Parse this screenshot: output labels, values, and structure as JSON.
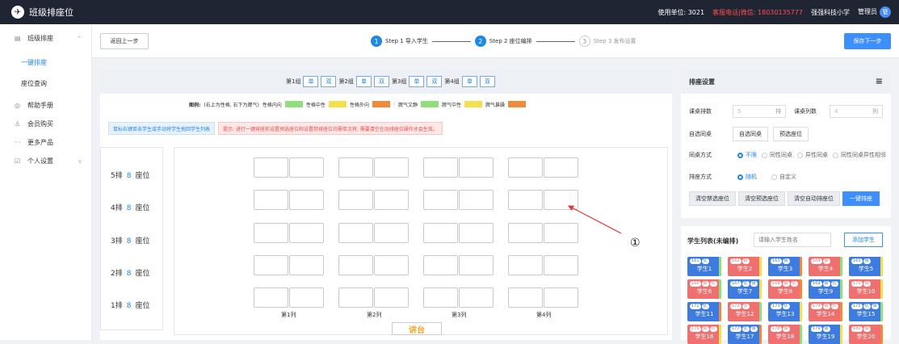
{
  "app": {
    "title": "班级排座位",
    "logo_glyph": "✈"
  },
  "topbar": {
    "unit": "使用单位: 3021",
    "hotline": "客服电话|微信: 18030135777",
    "school": "强强科技小学",
    "user": "管理员",
    "avatar_glyph": "管"
  },
  "sidebar": {
    "items": [
      {
        "label": "班级排座",
        "icon": "▤",
        "arrow": "^"
      },
      {
        "label": "一键排座"
      },
      {
        "label": "座位查询"
      },
      {
        "label": "帮助手册",
        "icon": "◎"
      },
      {
        "label": "会员购买",
        "icon": "♙"
      },
      {
        "label": "更多产品",
        "icon": "···"
      },
      {
        "label": "个人设置",
        "icon": "☑",
        "arrow": "v"
      }
    ]
  },
  "header": {
    "back": "返回上一步",
    "next": "保存下一步",
    "steps": [
      {
        "num": "1",
        "label": "Step 1 导入学生"
      },
      {
        "num": "2",
        "label": "Step 2 座位编排"
      },
      {
        "num": "3",
        "label": "Step 3 发布设置"
      }
    ]
  },
  "groups": [
    {
      "label": "第1组",
      "a": "单",
      "b": "双"
    },
    {
      "label": "第2组",
      "a": "单",
      "b": "双"
    },
    {
      "label": "第3组",
      "a": "单",
      "b": "双"
    },
    {
      "label": "第4组",
      "a": "单",
      "b": "双"
    }
  ],
  "legend": {
    "title": "图例:",
    "note": "(右上为性格, 右下为脾气)",
    "items": [
      {
        "label": "性格内向",
        "color": "#8ee07a"
      },
      {
        "label": "性格中性",
        "color": "#f5e04a"
      },
      {
        "label": "性格外向",
        "color": "#f08a3a"
      },
      {
        "label": "脾气文静",
        "color": "#8ee07a"
      },
      {
        "label": "脾气中性",
        "color": "#f5e04a"
      },
      {
        "label": "脾气暴躁",
        "color": "#f08a3a"
      }
    ]
  },
  "tips": {
    "blue": "鼠标右键单击学生或手动将学生拖回学生列表",
    "red": "提示: 进行一键排座前设置预选座位和设置禁排座位均需单次将, 需要清空在动排座位操作才会生效。"
  },
  "rows": [
    {
      "label": "5排",
      "count": "8",
      "suffix": "座位"
    },
    {
      "label": "4排",
      "count": "8",
      "suffix": "座位"
    },
    {
      "label": "3排",
      "count": "8",
      "suffix": "座位"
    },
    {
      "label": "2排",
      "count": "8",
      "suffix": "座位"
    },
    {
      "label": "1排",
      "count": "8",
      "suffix": "座位"
    }
  ],
  "columns": [
    "第1列",
    "第2列",
    "第3列",
    "第4列"
  ],
  "podium": "讲台",
  "annotation": "①",
  "settings": {
    "title": "排座设置",
    "desk_rows_label": "课桌排数",
    "desk_rows_value": "5",
    "desk_rows_unit": "排",
    "desk_cols_label": "课桌列数",
    "desk_cols_value": "4",
    "desk_cols_unit": "列",
    "self_select_label": "自选同桌",
    "self_select_btn": "自选同桌",
    "preselect_btn": "预选座位",
    "desk_mode_label": "同桌方式",
    "desk_modes": [
      "不限",
      "同性同桌",
      "异性同桌",
      "同性同桌异性相邻"
    ],
    "seat_mode_label": "排座方式",
    "seat_modes": [
      "随机",
      "自定义"
    ],
    "btn_clear_forbid": "清空禁选座位",
    "btn_clear_pre": "清空预选座位",
    "btn_clear_auto": "清空自动排座位",
    "btn_auto": "一键排座"
  },
  "students": {
    "title": "学生列表(未编排)",
    "search_placeholder": "请输入学生姓名",
    "add": "添加学生",
    "list": [
      {
        "name": "学生1",
        "tags": [
          "161",
          "优"
        ],
        "g": "m",
        "c": "#8ee07a"
      },
      {
        "name": "学生2",
        "tags": [
          "162",
          "良"
        ],
        "g": "f",
        "c": "#f5e04a"
      },
      {
        "name": "学生3",
        "tags": [
          "163",
          "良"
        ],
        "g": "m",
        "c": "#f08a3a"
      },
      {
        "name": "学生4",
        "tags": [
          "164",
          "良"
        ],
        "g": "f",
        "c": "#8ee07a"
      },
      {
        "name": "学生5",
        "tags": [
          "165",
          "良"
        ],
        "g": "m",
        "c": "#f5e04a"
      },
      {
        "name": "学生6",
        "tags": [
          "166",
          "良",
          "优"
        ],
        "g": "f",
        "c": "#8ee07a"
      },
      {
        "name": "学生7",
        "tags": [
          "167",
          "优",
          "良"
        ],
        "g": "m",
        "c": "#f5e04a"
      },
      {
        "name": "学生8",
        "tags": [
          "168",
          "良",
          "优"
        ],
        "g": "f",
        "c": "#f08a3a"
      },
      {
        "name": "学生9",
        "tags": [
          "169",
          "良",
          "优"
        ],
        "g": "m",
        "c": "#8ee07a"
      },
      {
        "name": "学生10",
        "tags": [
          "170",
          "良"
        ],
        "g": "f",
        "c": "#f5e04a"
      },
      {
        "name": "学生11",
        "tags": [
          "171",
          "优"
        ],
        "g": "m",
        "c": "#f08a3a"
      },
      {
        "name": "学生12",
        "tags": [
          "172",
          "优"
        ],
        "g": "f",
        "c": "#8ee07a"
      },
      {
        "name": "学生13",
        "tags": [
          "173",
          "优"
        ],
        "g": "m",
        "c": "#f5e04a"
      },
      {
        "name": "学生14",
        "tags": [
          "174",
          "良",
          "优"
        ],
        "g": "f",
        "c": "#f08a3a"
      },
      {
        "name": "学生15",
        "tags": [
          "175",
          "优",
          "良"
        ],
        "g": "m",
        "c": "#8ee07a"
      },
      {
        "name": "学生16",
        "tags": [
          "176",
          "良",
          "优"
        ],
        "g": "f",
        "c": "#f5e04a"
      },
      {
        "name": "学生17",
        "tags": [
          "177",
          "优",
          "良"
        ],
        "g": "m",
        "c": "#f08a3a"
      },
      {
        "name": "学生18",
        "tags": [
          "178",
          "良"
        ],
        "g": "f",
        "c": "#8ee07a"
      },
      {
        "name": "学生19",
        "tags": [
          "179",
          "良"
        ],
        "g": "m",
        "c": "#f5e04a"
      },
      {
        "name": "学生20",
        "tags": [
          "180",
          "良"
        ],
        "g": "f",
        "c": "#f08a3a"
      }
    ]
  }
}
